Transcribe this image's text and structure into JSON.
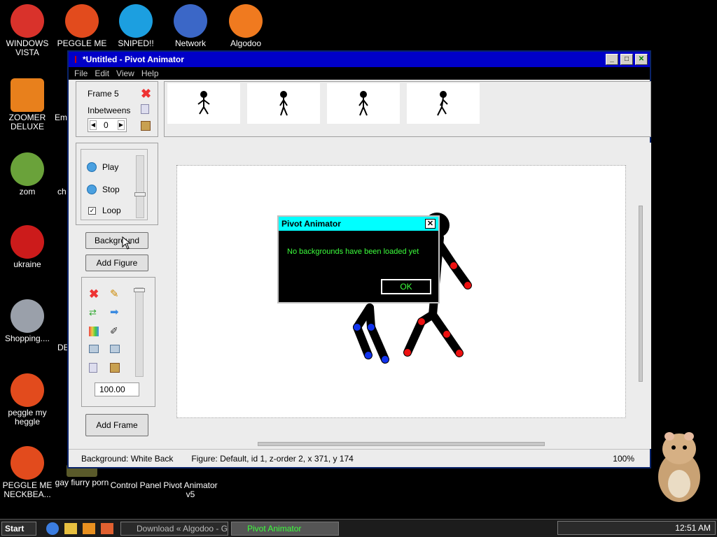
{
  "desktop": {
    "icons": [
      {
        "label": "WINDOWS VISTA",
        "color": "#d9322b"
      },
      {
        "label": "PEGGLE ME",
        "color": "#e24b1d"
      },
      {
        "label": "SNIPED!!",
        "color": "#1c9fe0"
      },
      {
        "label": "Network",
        "color": "#3b67c7"
      },
      {
        "label": "Algodoo",
        "color": "#f07a1f"
      },
      {
        "label": "ZOOMER DELUXE",
        "color": "#e8801c"
      },
      {
        "label": "Em",
        "color": "#444444"
      },
      {
        "label": "zom",
        "color": "#6aa23a"
      },
      {
        "label": "ch",
        "color": "#444444"
      },
      {
        "label": "ukraine",
        "color": "#cc1b1b"
      },
      {
        "label": "Shopping....",
        "color": "#9aa0aa"
      },
      {
        "label": "DE",
        "color": "#444444"
      },
      {
        "label": "peggle my heggle",
        "color": "#e24b1d"
      },
      {
        "label": "PEGGLE ME NECKBEA...",
        "color": "#e24b1d"
      },
      {
        "label": "gay fiurry porn",
        "color": "#5a5a2a"
      },
      {
        "label": "Control Panel",
        "color": "#333333"
      },
      {
        "label": "Pivot Animator v5",
        "color": "#bb1111"
      }
    ]
  },
  "window": {
    "title": "*Untitled - Pivot Animator",
    "menu": [
      "File",
      "Edit",
      "View",
      "Help"
    ],
    "frame_label": "Frame 5",
    "inbetweens_label": "Inbetweens",
    "inbetweens_value": "0",
    "play_label": "Play",
    "stop_label": "Stop",
    "loop_label": "Loop",
    "background_button": "Background",
    "add_figure_button": "Add Figure",
    "scale_value": "100.00",
    "add_frame_button": "Add Frame",
    "status": {
      "background": "Background: White Back",
      "figure": "Figure: Default,  id 1,  z-order 2,  x 371, y 174",
      "zoom": "100%"
    }
  },
  "dialog": {
    "title": "Pivot Animator",
    "message": "No backgrounds have been loaded yet",
    "ok_label": "OK"
  },
  "taskbar": {
    "start_label": "Start",
    "tasks": [
      "Download « Algodoo - Go...",
      "Pivot Animator"
    ],
    "clock": "12:51 AM"
  }
}
